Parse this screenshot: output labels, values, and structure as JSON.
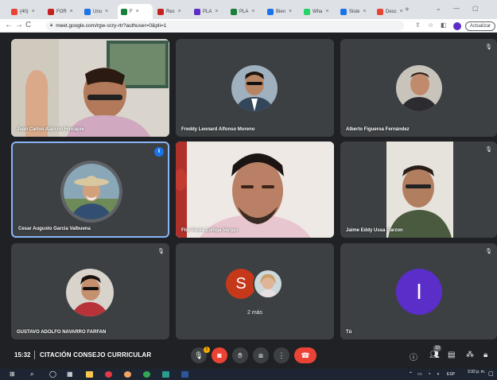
{
  "browser": {
    "tabs": [
      {
        "label": "(40)",
        "fav": "#ea4335"
      },
      {
        "label": "FOR",
        "fav": "#c5221f"
      },
      {
        "label": "Unu",
        "fav": "#1a73e8"
      },
      {
        "label": "F",
        "fav": "#188038",
        "active": true
      },
      {
        "label": "Rec",
        "fav": "#c5221f"
      },
      {
        "label": "PLA",
        "fav": "#5b2ec9"
      },
      {
        "label": "PLA",
        "fav": "#188038"
      },
      {
        "label": "Bien",
        "fav": "#1a73e8"
      },
      {
        "label": "Wha",
        "fav": "#25d366"
      },
      {
        "label": "Siste",
        "fav": "#1a73e8"
      },
      {
        "label": "Desc",
        "fav": "#ea4335"
      }
    ],
    "new_tab": "+",
    "url": "meet.google.com/rgw-srzy-rtr?authuser=0&pli=1",
    "update_label": "Actualizar"
  },
  "tiles": [
    {
      "name": "Juan Carlos Alarcon Hincapie"
    },
    {
      "name": "Freddy Leonard Alfonso Moreno"
    },
    {
      "name": "Alberto Figueroa Fernández"
    },
    {
      "name": "Cesar Augusto Garcia Valbuena"
    },
    {
      "name": "Flor Paola Zuñiga Vargas"
    },
    {
      "name": "Jaime Eddy Ussa Garzon"
    },
    {
      "name": "GUSTAVO ADOLFO NAVARRO FARFAN"
    },
    {
      "name": "",
      "letter": "S",
      "more": "2 más"
    },
    {
      "name": "Tú",
      "letter": "I"
    }
  ],
  "colors": {
    "meet_bg": "#202124",
    "tile_bg": "#3c4043",
    "accent_blue": "#1a73e8",
    "end_call_red": "#ea4335",
    "avatar_s": "#c5391a",
    "avatar_i": "#5b2ec9"
  },
  "controls": {
    "time": "15:32",
    "meeting_title": "CITACIÓN CONSEJO CURRICULAR",
    "people_count": "10",
    "buttons": [
      "mic-icon",
      "camera-off-icon",
      "raise-hand-icon",
      "present-icon",
      "more-icon",
      "end-call-icon"
    ],
    "right_buttons": [
      "info-icon",
      "people-icon",
      "chat-icon",
      "activities-icon",
      "lock-icon"
    ]
  },
  "taskbar": {
    "language": "ESP",
    "time": "3:32 p. m."
  }
}
